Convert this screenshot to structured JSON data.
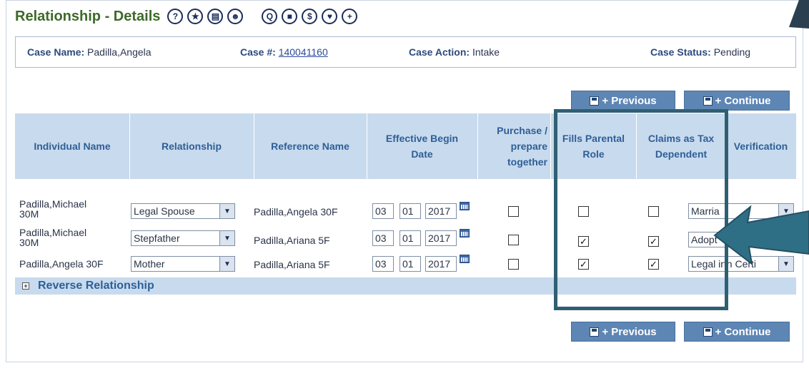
{
  "title": "Relationship - Details",
  "title_icons": [
    {
      "name": "help-icon",
      "glyph": "?"
    },
    {
      "name": "star-icon",
      "glyph": "★"
    },
    {
      "name": "document-icon",
      "glyph": "▤"
    },
    {
      "name": "person-icon",
      "glyph": "☻"
    },
    {
      "name": "q-icon",
      "glyph": "Q"
    },
    {
      "name": "stop-icon",
      "glyph": "■"
    },
    {
      "name": "dollar-icon",
      "glyph": "$"
    },
    {
      "name": "chat-icon",
      "glyph": "♥"
    },
    {
      "name": "chat-plus-icon",
      "glyph": "+"
    }
  ],
  "case": {
    "name_label": "Case Name:",
    "name_value": "Padilla,Angela",
    "number_label": "Case #:",
    "number_value": "140041160",
    "action_label": "Case Action:",
    "action_value": "Intake",
    "status_label": "Case Status:",
    "status_value": "Pending"
  },
  "buttons": {
    "previous": "+ Previous",
    "continue": "+ Continue"
  },
  "columns": {
    "individual": "Individual Name",
    "relationship": "Relationship",
    "reference": "Reference Name",
    "effective": "Effective Begin Date",
    "purchase": "Purchase / prepare together",
    "fills": "Fills Parental Role",
    "claims": "Claims as Tax Dependent",
    "verification": "Verification"
  },
  "rows": [
    {
      "name1": "Padilla,Michael",
      "name2": "30M",
      "relationship": "Legal Spouse",
      "reference": "Padilla,Angela 30F",
      "month": "03",
      "day": "01",
      "year": "2017",
      "purchase": false,
      "fills": false,
      "claims": false,
      "verification": "Marria"
    },
    {
      "name1": "Padilla,Michael",
      "name2": "30M",
      "relationship": "Stepfather",
      "reference": "Padilla,Ariana 5F",
      "month": "03",
      "day": "01",
      "year": "2017",
      "purchase": false,
      "fills": true,
      "claims": true,
      "verification": "Adopt"
    },
    {
      "name1": "Padilla,Angela 30F",
      "name2": "",
      "relationship": "Mother",
      "reference": "Padilla,Ariana 5F",
      "month": "03",
      "day": "01",
      "year": "2017",
      "purchase": false,
      "fills": true,
      "claims": true,
      "verification": "Legal irth Certi"
    }
  ],
  "reverse": "Reverse Relationship",
  "colors": {
    "title": "#3d6a2a",
    "header_bg": "#c8daed",
    "header_text": "#2e5f97",
    "button_bg": "#5d86b4",
    "highlight": "#2f5f73"
  }
}
